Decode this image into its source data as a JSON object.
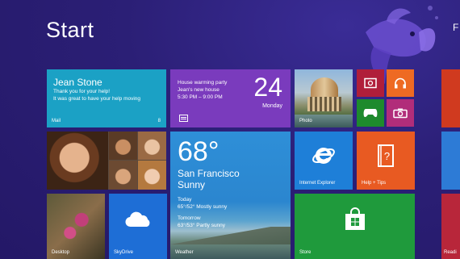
{
  "header": {
    "title": "Start",
    "user_initial": "F"
  },
  "tiles": {
    "mail": {
      "label": "Mail",
      "from": "Jean Stone",
      "line1": "Thank you for your help!",
      "line2": "It was great to have your help moving",
      "count": "8"
    },
    "calendar": {
      "event_line1": "House warming party",
      "event_line2": "Jean's new house",
      "event_line3": "5:30 PM – 9:00 PM",
      "day_number": "24",
      "weekday": "Monday"
    },
    "photo": {
      "label": "Photo"
    },
    "people": {},
    "weather": {
      "temperature": "68°",
      "city": "San Francisco",
      "condition": "Sunny",
      "today_label": "Today",
      "today_forecast": "65°/52° Mostly sunny",
      "tomorrow_label": "Tomorrow",
      "tomorrow_forecast": "63°/53° Partly sunny",
      "label": "Weather"
    },
    "ie": {
      "label": "Internet Explorer"
    },
    "help": {
      "label": "Help + Tips"
    },
    "desktop": {
      "label": "Desktop"
    },
    "skydrive": {
      "label": "SkyDrive"
    },
    "store": {
      "label": "Store"
    },
    "edge_bottom": {
      "label": "Readi"
    }
  },
  "icons": {
    "video": "video-icon",
    "music": "headphones-icon",
    "games": "xbox-controller-icon",
    "camera": "camera-icon",
    "ie": "internet-explorer-icon",
    "help": "help-book-icon",
    "skydrive": "cloud-icon",
    "store": "store-bag-icon",
    "calendar": "calendar-icon"
  },
  "colors": {
    "background": "#2b1f76",
    "mail": "#1ba1c5",
    "calendar": "#7a3bbd",
    "video": "#b01e3a",
    "music": "#ee6a23",
    "games": "#1e8a2d",
    "camera": "#b12d7a",
    "ie": "#1e7fd8",
    "help": "#e85a22",
    "skydrive": "#1e6ed6",
    "store": "#1f9a3c"
  }
}
